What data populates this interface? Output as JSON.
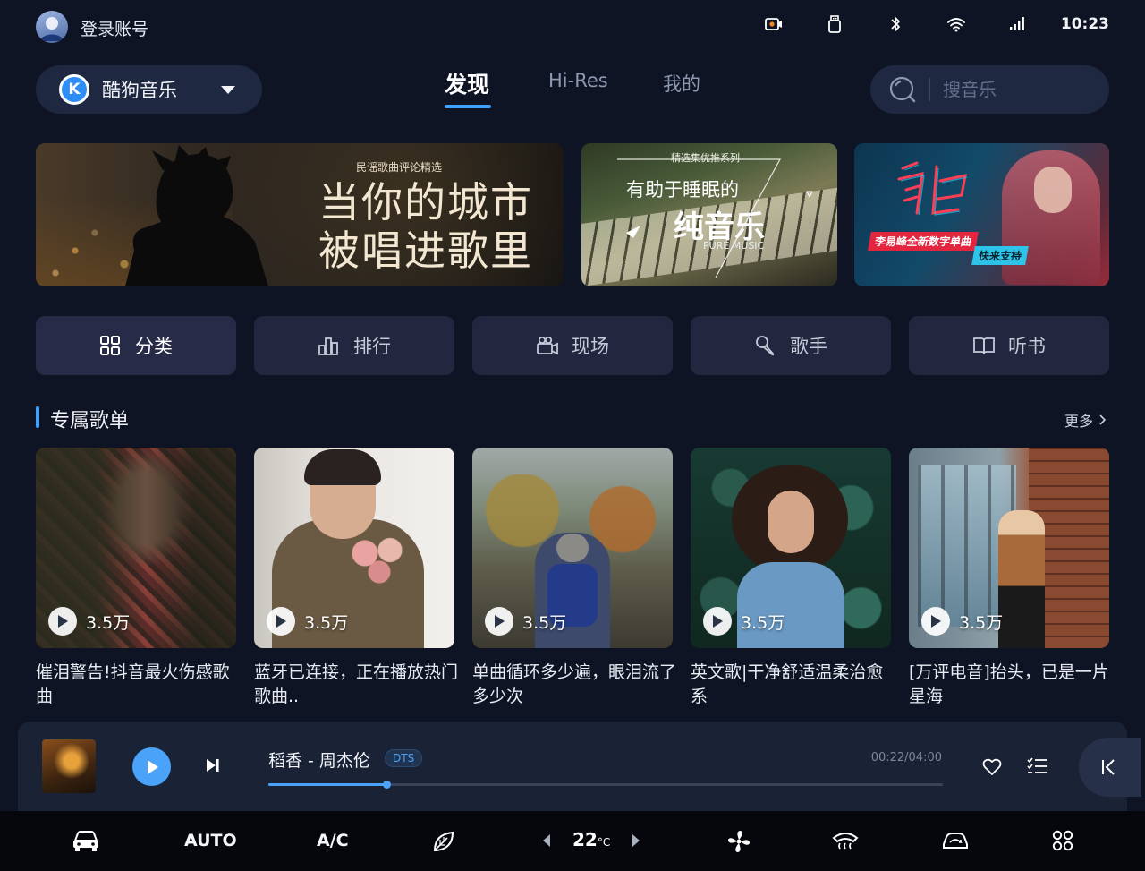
{
  "status": {
    "login_text": "登录账号",
    "time": "10:23",
    "icons": [
      "record-icon",
      "usb-icon",
      "bluetooth-icon",
      "wifi-icon",
      "signal-icon"
    ]
  },
  "app": {
    "name": "酷狗音乐",
    "logo_letter": "K"
  },
  "tabs": [
    {
      "label": "发现",
      "active": true
    },
    {
      "label": "Hi-Res",
      "active": false
    },
    {
      "label": "我的",
      "active": false
    }
  ],
  "search": {
    "placeholder": "搜音乐"
  },
  "banners": [
    {
      "subtitle": "民谣歌曲评论精选",
      "line1": "当你的城市",
      "line2": "被唱进歌里"
    },
    {
      "series": "精选集优推系列",
      "line1": "有助于睡眠的",
      "line2": "纯音乐",
      "line3": "PURE MUSIC"
    },
    {
      "tag1": "李易峰全新数字单曲",
      "tag2": "快来支持"
    }
  ],
  "categories": [
    {
      "label": "分类",
      "icon": "grid-icon"
    },
    {
      "label": "排行",
      "icon": "chart-icon"
    },
    {
      "label": "现场",
      "icon": "video-camera-icon"
    },
    {
      "label": "歌手",
      "icon": "microphone-icon"
    },
    {
      "label": "听书",
      "icon": "book-icon"
    }
  ],
  "section": {
    "title": "专属歌单",
    "more": "更多"
  },
  "playlists": [
    {
      "count": "3.5万",
      "title": "催泪警告!抖音最火伤感歌曲"
    },
    {
      "count": "3.5万",
      "title": "蓝牙已连接，正在播放热门歌曲.."
    },
    {
      "count": "3.5万",
      "title": "单曲循环多少遍，眼泪流了多少次"
    },
    {
      "count": "3.5万",
      "title": "英文歌|干净舒适温柔治愈系"
    },
    {
      "count": "3.5万",
      "title": "[万评电音]抬头，已是一片星海"
    }
  ],
  "player": {
    "song": "稻香 - 周杰伦",
    "badge": "DTS",
    "time": "00:22/04:00",
    "progress": 0.175
  },
  "climate": {
    "auto": "AUTO",
    "ac": "A/C",
    "temp": "22",
    "unit": "°C"
  },
  "colors": {
    "accent": "#3fa2ff",
    "background": "#0e1424"
  }
}
